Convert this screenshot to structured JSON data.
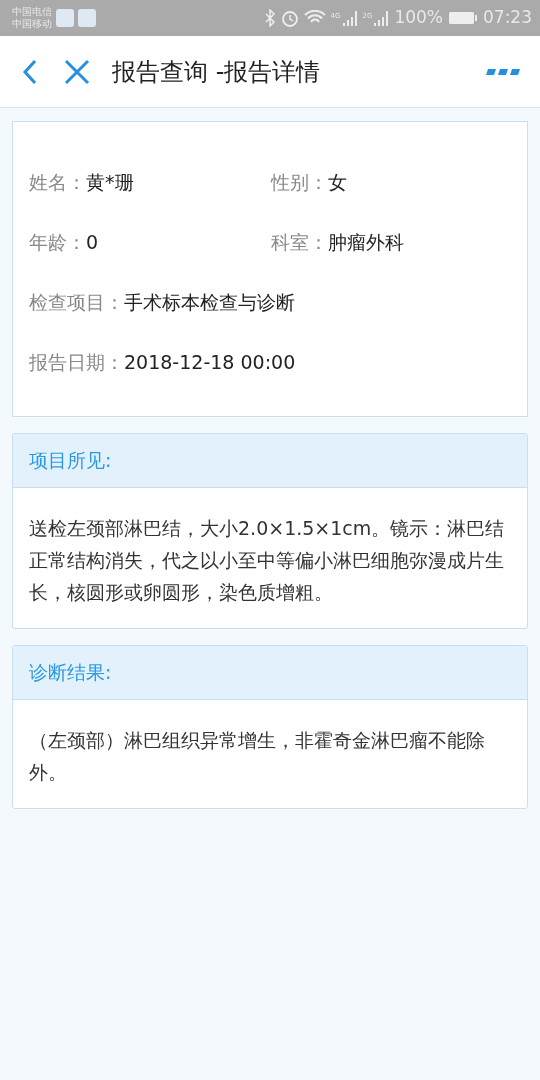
{
  "status_bar": {
    "carriers": [
      "中国电信",
      "中国移动"
    ],
    "network_1": "4G",
    "network_2": "2G",
    "battery_text": "100%",
    "time": "07:23"
  },
  "header": {
    "title": "报告查询 -报告详情"
  },
  "info_rows": [
    [
      {
        "label": "姓名：",
        "value": "黄*珊"
      },
      {
        "label": "性别：",
        "value": "女"
      }
    ],
    [
      {
        "label": "年龄：",
        "value": "0"
      },
      {
        "label": "科室：",
        "value": "肿瘤外科"
      }
    ],
    [
      {
        "label": "检查项目：",
        "value": "手术标本检查与诊断"
      }
    ],
    [
      {
        "label": "报告日期：",
        "value": "2018-12-18 00:00"
      }
    ]
  ],
  "sections": [
    {
      "title": "项目所见:",
      "text": "送检左颈部淋巴结，大小2.0×1.5×1cm。镜示：淋巴结正常结构消失，代之以小至中等偏小淋巴细胞弥漫成片生长，核圆形或卵圆形，染色质增粗。"
    },
    {
      "title": "诊断结果:",
      "text": "（左颈部）淋巴组织异常增生，非霍奇金淋巴瘤不能除外。"
    }
  ]
}
